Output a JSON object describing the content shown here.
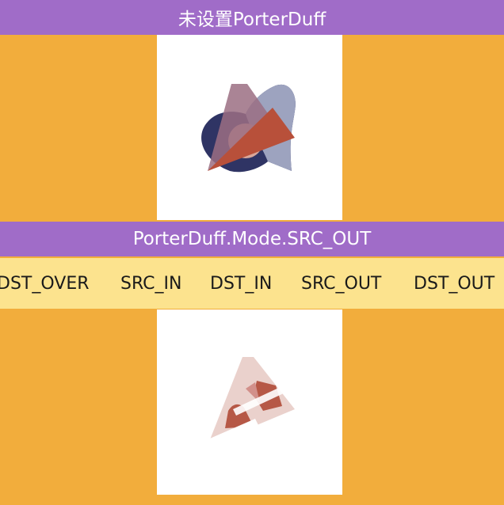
{
  "header": {
    "title": "未设置PorterDuff"
  },
  "mode_header": {
    "title": "PorterDuff.Mode.SRC_OUT"
  },
  "mode_selector": {
    "items": [
      "DST_OVER",
      "SRC_IN",
      "DST_IN",
      "SRC_OUT",
      "DST_OUT"
    ],
    "selected": "SRC_OUT"
  },
  "colors": {
    "title_bar": "#a06cc8",
    "background": "#f2ad3c",
    "mode_strip": "#fce38e",
    "canvas": "#ffffff",
    "dst_shape": "#2f3464",
    "dst_shape_light": "#9da3bf",
    "src_triangle": "#b8503a"
  }
}
